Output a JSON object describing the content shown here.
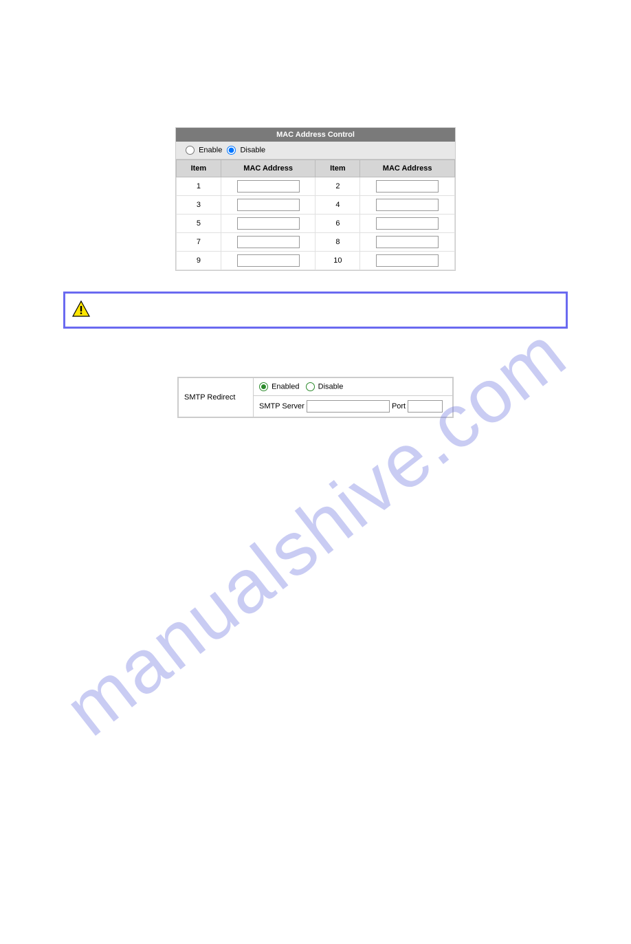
{
  "mac_section": {
    "title": "MAC Address Control",
    "enable_label": "Enable",
    "disable_label": "Disable",
    "selected": "disable",
    "headers": {
      "item": "Item",
      "mac": "MAC Address"
    },
    "rows": [
      {
        "left_num": "1",
        "left_val": "",
        "right_num": "2",
        "right_val": ""
      },
      {
        "left_num": "3",
        "left_val": "",
        "right_num": "4",
        "right_val": ""
      },
      {
        "left_num": "5",
        "left_val": "",
        "right_num": "6",
        "right_val": ""
      },
      {
        "left_num": "7",
        "left_val": "",
        "right_num": "8",
        "right_val": ""
      },
      {
        "left_num": "9",
        "left_val": "",
        "right_num": "10",
        "right_val": ""
      }
    ]
  },
  "smtp_section": {
    "label": "SMTP Redirect",
    "enabled_label": "Enabled",
    "disable_label": "Disable",
    "selected": "enabled",
    "server_label": "SMTP Server",
    "port_label": "Port",
    "server_value": "",
    "port_value": ""
  },
  "watermark": "manualshive.com"
}
